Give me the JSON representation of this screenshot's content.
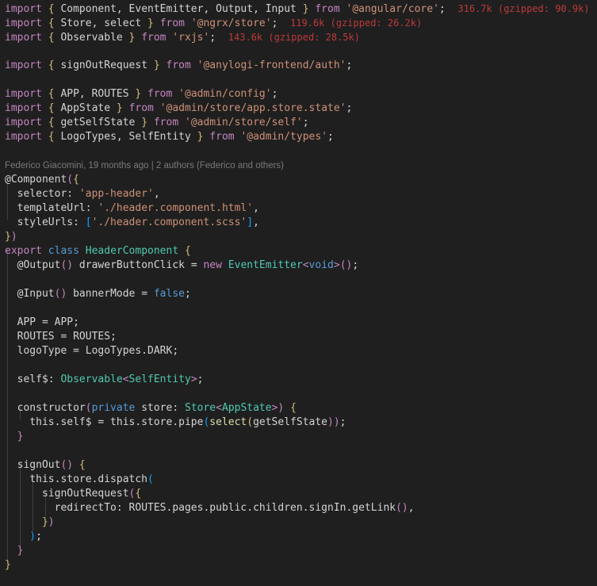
{
  "editor": {
    "language": "typescript",
    "background_color": "#1f1f1f",
    "foreground_color": "#d4d4d4",
    "indent_guide_color": "#404040",
    "import_cost_color": "#bb3a3a",
    "blame_color": "#8a8a8a"
  },
  "blame_annotation": {
    "text": "Federico Giacomini, 19 months ago | 2 authors (Federico and others)",
    "author": "Federico Giacomini",
    "age": "19 months ago",
    "authors": "2 authors (Federico and others)"
  },
  "import_costs": [
    {
      "line": 1,
      "size": "316.7k",
      "gzipped": "(gzipped: 90.9k)",
      "full": "316.7k (gzipped: 90.9k)"
    },
    {
      "line": 2,
      "size": "119.6k",
      "gzipped": "(gzipped: 26.2k)",
      "full": "119.6k (gzipped: 26.2k)"
    },
    {
      "line": 3,
      "size": "143.6k",
      "gzipped": "(gzipped: 28.5k)",
      "full": "143.6k (gzipped: 28.5k)"
    }
  ],
  "code": {
    "l1": {
      "kw_import": "import",
      "brace_open": "{",
      "names": " Component, EventEmitter, Output, Input ",
      "brace_close": "}",
      "kw_from": "from",
      "module": "'@angular/core'",
      "semi": ";",
      "cost": "316.7k (gzipped: 90.9k)"
    },
    "l2": {
      "kw_import": "import",
      "brace_open": "{",
      "names": " Store, select ",
      "brace_close": "}",
      "kw_from": "from",
      "module": "'@ngrx/store'",
      "semi": ";",
      "cost": "119.6k (gzipped: 26.2k)"
    },
    "l3": {
      "kw_import": "import",
      "brace_open": "{",
      "names": " Observable ",
      "brace_close": "}",
      "kw_from": "from",
      "module": "'rxjs'",
      "semi": ";",
      "cost": "143.6k (gzipped: 28.5k)"
    },
    "l5": {
      "kw_import": "import",
      "brace_open": "{",
      "names": " signOutRequest ",
      "brace_close": "}",
      "kw_from": "from",
      "module": "'@anylogi-frontend/auth'",
      "semi": ";"
    },
    "l7": {
      "kw_import": "import",
      "brace_open": "{",
      "names": " APP, ROUTES ",
      "brace_close": "}",
      "kw_from": "from",
      "module": "'@admin/config'",
      "semi": ";"
    },
    "l8": {
      "kw_import": "import",
      "brace_open": "{",
      "names": " AppState ",
      "brace_close": "}",
      "kw_from": "from",
      "module": "'@admin/store/app.store.state'",
      "semi": ";"
    },
    "l9": {
      "kw_import": "import",
      "brace_open": "{",
      "names": " getSelfState ",
      "brace_close": "}",
      "kw_from": "from",
      "module": "'@admin/store/self'",
      "semi": ";"
    },
    "l10": {
      "kw_import": "import",
      "brace_open": "{",
      "names": " LogoTypes, SelfEntity ",
      "brace_close": "}",
      "kw_from": "from",
      "module": "'@admin/types'",
      "semi": ";"
    },
    "l12": {
      "decorator": "@Component",
      "paren": "(",
      "brace": "{"
    },
    "l13": {
      "key": "  selector:",
      "value": " 'app-header'",
      "comma": ","
    },
    "l14": {
      "key": "  templateUrl:",
      "value": " './header.component.html'",
      "comma": ","
    },
    "l15": {
      "key": "  styleUrls:",
      "bracket_open": " [",
      "value": "'./header.component.scss'",
      "bracket_close": "]",
      "comma": ","
    },
    "l16": {
      "brace": "}",
      "paren": ")"
    },
    "l17": {
      "kw_export": "export",
      "kw_class": "class",
      "name": " HeaderComponent ",
      "brace": "{"
    },
    "l18": {
      "decorator": "  @Output",
      "paren": "()",
      "name": " drawerButtonClick ",
      "eq": "= ",
      "kw_new": "new",
      "type": " EventEmitter",
      "lt": "<",
      "generic": "void",
      "gt": ">",
      "call": "()",
      "semi": ";"
    },
    "l20": {
      "decorator": "  @Input",
      "paren": "()",
      "name": " bannerMode ",
      "eq": "= ",
      "value": "false",
      "semi": ";"
    },
    "l22": {
      "text": "  APP = APP;"
    },
    "l23": {
      "text": "  ROUTES = ROUTES;"
    },
    "l24": {
      "text": "  logoType = LogoTypes.DARK;"
    },
    "l26": {
      "name": "  self$:",
      "type": " Observable",
      "lt": "<",
      "generic": "SelfEntity",
      "gt": ">",
      "semi": ";"
    },
    "l28": {
      "kw_ctor": "  constructor",
      "paren_open": "(",
      "kw_private": "private",
      "param": " store:",
      "type": " Store",
      "lt": "<",
      "generic": "AppState",
      "gt": ">",
      "paren_close": ")",
      "brace": " {"
    },
    "l29": {
      "text": "    this.self$ = this.store.pipe",
      "paren1": "(",
      "fn": "select",
      "paren2": "(",
      "arg": "getSelfState",
      "close": "))",
      "semi": ";"
    },
    "l30": {
      "brace": "  }"
    },
    "l32": {
      "fn": "  signOut",
      "paren": "()",
      "brace": " {"
    },
    "l33": {
      "text": "    this.store.dispatch",
      "paren": "("
    },
    "l34": {
      "fn": "      signOutRequest",
      "paren": "(",
      "brace": "{"
    },
    "l35": {
      "key": "        redirectTo:",
      "chain": " ROUTES.pages.public.children.signIn.getLink",
      "paren": "()",
      "comma": ","
    },
    "l36": {
      "brace": "      }",
      "paren": ")"
    },
    "l37": {
      "paren": "    )",
      "semi": ";"
    },
    "l38": {
      "brace": "  }"
    },
    "l39": {
      "brace": "}"
    }
  }
}
